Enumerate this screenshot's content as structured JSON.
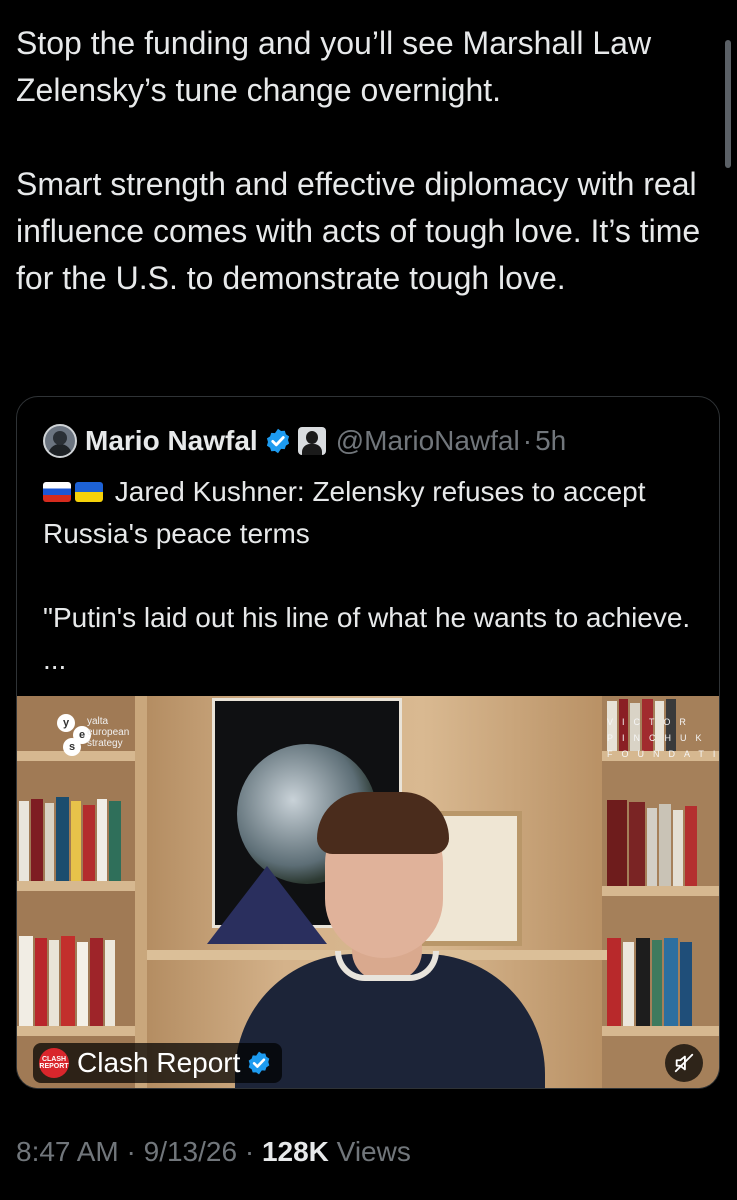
{
  "tweet": {
    "paragraph_1": "Stop the funding and you’ll see Marshall Law Zelensky’s tune change overnight.",
    "paragraph_2": "Smart strength and effective diplomacy with real influence comes with acts of tough love. It’s time for the U.S. to demonstrate tough love."
  },
  "quote": {
    "name": "Mario Nawfal",
    "handle": "@MarioNawfal",
    "separator": "·",
    "time": "5h",
    "line_1": "Jared Kushner: Zelensky refuses to accept Russia's peace terms",
    "line_2": "\"Putin's laid out his line of what he wants to achieve. ...",
    "flags": [
      "russia-flag",
      "ukraine-flag"
    ]
  },
  "video": {
    "logo_letters": [
      "y",
      "e",
      "s"
    ],
    "logo_text": "yalta european strategy",
    "backdrop_text": "VICTOR PINCHUK FOUNDATION",
    "source_badge_logo": "CLASH REPORT",
    "source_badge": "Clash Report",
    "muted": true
  },
  "meta": {
    "time": "8:47 AM",
    "sep": "·",
    "date": "9/13/26",
    "views_count": "128K",
    "views_label": "Views"
  },
  "colors": {
    "background": "#000000",
    "text": "#e7e9ea",
    "muted_text": "#71767b",
    "verified_blue": "#1d9bf0",
    "border": "#2f3336"
  }
}
